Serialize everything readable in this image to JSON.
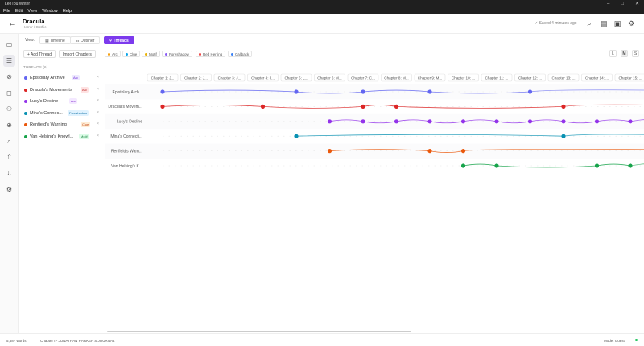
{
  "window": {
    "title": "LeoTou Writer",
    "controls": [
      "–",
      "□",
      "✕"
    ]
  },
  "menu": [
    "File",
    "Edit",
    "View",
    "Window",
    "Help"
  ],
  "header": {
    "back_icon": "←",
    "title": "Dracula",
    "subtitle": "Horror / Gothic",
    "saved": "✓ Saved 4 minutes ago",
    "icons": [
      "⌕",
      "▤",
      "▣",
      "⚙"
    ]
  },
  "rail_icons": [
    "▭",
    "☰",
    "⊘",
    "◻",
    "⚇",
    "⊕",
    "⌕",
    "⇧",
    "⇩",
    "⚙"
  ],
  "view": {
    "label": "View:",
    "buttons": [
      {
        "label": "▦ Timeline",
        "active": false
      },
      {
        "label": "☷ Outliner",
        "active": false
      },
      {
        "label": "⑂ Threads",
        "active": true
      }
    ]
  },
  "filters": {
    "add_thread": "+ Add Thread",
    "import_chapters": "Import Chapters",
    "tags": [
      {
        "label": "Arc",
        "color": "#f59e0b"
      },
      {
        "label": "Clue",
        "color": "#0ea5e9"
      },
      {
        "label": "Motif",
        "color": "#eab308"
      },
      {
        "label": "Foreshadow",
        "color": "#8b5cf6"
      },
      {
        "label": "Red Herring",
        "color": "#ef4444"
      },
      {
        "label": "Callback",
        "color": "#3b82f6"
      }
    ],
    "sizes": [
      {
        "label": "L",
        "active": false
      },
      {
        "label": "M",
        "active": true
      },
      {
        "label": "S",
        "active": false
      }
    ]
  },
  "threads_panel": {
    "heading": "THREADS (6)",
    "remove_icon": "×",
    "items": [
      {
        "name": "Epistolary Archive",
        "badge": "Arc",
        "color": "#6366f1",
        "badge_bg": "#ede9fe",
        "badge_fg": "#6d28d9"
      },
      {
        "name": "Dracula's Movements",
        "badge": "Arc",
        "color": "#dc2626",
        "badge_bg": "#fee2e2",
        "badge_fg": "#b91c1c"
      },
      {
        "name": "Lucy's Decline",
        "badge": "Arc",
        "color": "#9333ea",
        "badge_bg": "#f3e8ff",
        "badge_fg": "#7e22ce"
      },
      {
        "name": "Mina's Connec...",
        "badge": "Foreshadow",
        "color": "#0891b2",
        "badge_bg": "#e0f2fe",
        "badge_fg": "#0369a1"
      },
      {
        "name": "Renfield's Warning",
        "badge": "Clue",
        "color": "#ea580c",
        "badge_bg": "#ffedd5",
        "badge_fg": "#c2410c"
      },
      {
        "name": "Van Helsing's Knowl...",
        "badge": "Motif",
        "color": "#16a34a",
        "badge_bg": "#dcfce7",
        "badge_fg": "#15803d"
      }
    ]
  },
  "timeline": {
    "chapters": [
      "Chapter 1: J...",
      "Chapter 2: J...",
      "Chapter 3: J...",
      "Chapter 4: J...",
      "Chapter 5: L...",
      "Chapter 6: M...",
      "Chapter 7: C...",
      "Chapter 8: M...",
      "Chapter 9: M...",
      "Chapter 10: ...",
      "Chapter 11: ...",
      "Chapter 12: ...",
      "Chapter 13: ...",
      "Chapter 14: ...",
      "Chapter 15: ..."
    ],
    "rows": [
      {
        "label": "Epistolary Arch...",
        "color": "#6366f1",
        "points": [
          0,
          4,
          6,
          8,
          11
        ]
      },
      {
        "label": "Dracula's Movem...",
        "color": "#dc2626",
        "points": [
          0,
          3,
          6,
          7,
          12
        ]
      },
      {
        "label": "Lucy's Decline",
        "color": "#9333ea",
        "points": [
          5,
          6,
          7,
          8,
          9,
          10,
          11,
          12,
          13,
          14
        ]
      },
      {
        "label": "Mina's Connecti...",
        "color": "#0891b2",
        "points": [
          4,
          12
        ]
      },
      {
        "label": "Renfield's Warn...",
        "color": "#ea580c",
        "points": [
          5,
          8,
          9
        ]
      },
      {
        "label": "Van Helsing's K...",
        "color": "#16a34a",
        "points": [
          9,
          10,
          13,
          14
        ]
      }
    ]
  },
  "status": {
    "words": "5,687 words",
    "chapter": "Chapter I - JONATHAN HARKER'S JOURNAL",
    "mode": "Mode: Guest"
  }
}
